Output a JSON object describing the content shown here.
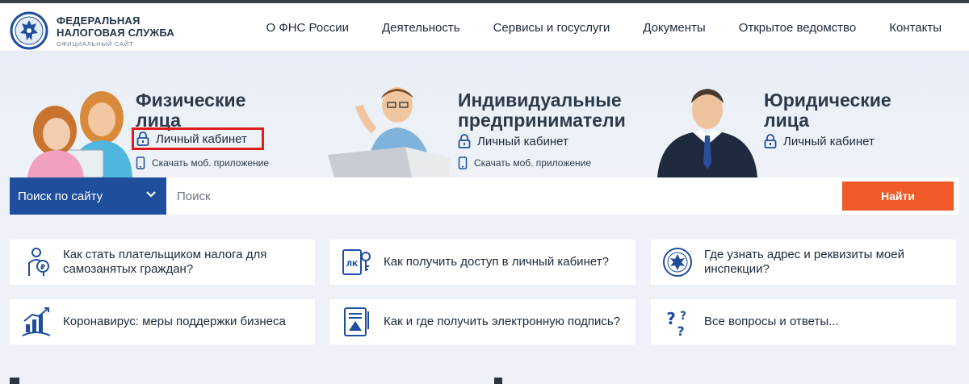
{
  "header": {
    "logo_line1": "ФЕДЕРАЛЬНАЯ",
    "logo_line2": "НАЛОГОВАЯ СЛУЖБА",
    "logo_line3": "ОФИЦИАЛЬНЫЙ САЙТ",
    "nav": [
      "О ФНС России",
      "Деятельность",
      "Сервисы и госуслуги",
      "Документы",
      "Открытое ведомство",
      "Контакты"
    ]
  },
  "categories": [
    {
      "title_line1": "Физические",
      "title_line2": "лица",
      "cabinet_label": "Личный кабинет",
      "app_label": "Скачать моб. приложение"
    },
    {
      "title_line1": "Индивидуальные",
      "title_line2": "предприниматели",
      "cabinet_label": "Личный кабинет",
      "app_label": "Скачать моб. приложение"
    },
    {
      "title_line1": "Юридические",
      "title_line2": "лица",
      "cabinet_label": "Личный кабинет"
    }
  ],
  "search": {
    "scope_label": "Поиск по сайту",
    "placeholder": "Поиск",
    "button_label": "Найти"
  },
  "faq": [
    {
      "text": "Как стать плательщиком налога для самозанятых граждан?",
      "icon": "self-employed-icon"
    },
    {
      "text": "Как получить доступ в личный кабинет?",
      "icon": "cabinet-key-icon"
    },
    {
      "text": "Где узнать адрес и реквизиты моей инспекции?",
      "icon": "emblem-icon"
    },
    {
      "text": "Коронавирус: меры поддержки бизнеса",
      "icon": "growth-chart-icon"
    },
    {
      "text": "Как и где получить электронную подпись?",
      "icon": "e-signature-icon"
    },
    {
      "text": "Все вопросы и ответы...",
      "icon": "questions-icon"
    }
  ],
  "colors": {
    "brand_blue": "#1f4e9c",
    "accent_orange": "#ef5a28",
    "highlight_red": "#e01b1b",
    "page_bg": "#eef2f8"
  }
}
